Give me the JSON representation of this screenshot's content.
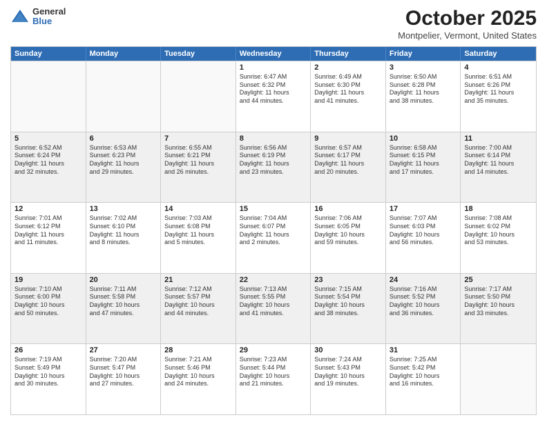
{
  "logo": {
    "general": "General",
    "blue": "Blue"
  },
  "header": {
    "month": "October 2025",
    "location": "Montpelier, Vermont, United States"
  },
  "days": [
    "Sunday",
    "Monday",
    "Tuesday",
    "Wednesday",
    "Thursday",
    "Friday",
    "Saturday"
  ],
  "weeks": [
    [
      {
        "day": "",
        "info": ""
      },
      {
        "day": "",
        "info": ""
      },
      {
        "day": "",
        "info": ""
      },
      {
        "day": "1",
        "info": "Sunrise: 6:47 AM\nSunset: 6:32 PM\nDaylight: 11 hours\nand 44 minutes."
      },
      {
        "day": "2",
        "info": "Sunrise: 6:49 AM\nSunset: 6:30 PM\nDaylight: 11 hours\nand 41 minutes."
      },
      {
        "day": "3",
        "info": "Sunrise: 6:50 AM\nSunset: 6:28 PM\nDaylight: 11 hours\nand 38 minutes."
      },
      {
        "day": "4",
        "info": "Sunrise: 6:51 AM\nSunset: 6:26 PM\nDaylight: 11 hours\nand 35 minutes."
      }
    ],
    [
      {
        "day": "5",
        "info": "Sunrise: 6:52 AM\nSunset: 6:24 PM\nDaylight: 11 hours\nand 32 minutes."
      },
      {
        "day": "6",
        "info": "Sunrise: 6:53 AM\nSunset: 6:23 PM\nDaylight: 11 hours\nand 29 minutes."
      },
      {
        "day": "7",
        "info": "Sunrise: 6:55 AM\nSunset: 6:21 PM\nDaylight: 11 hours\nand 26 minutes."
      },
      {
        "day": "8",
        "info": "Sunrise: 6:56 AM\nSunset: 6:19 PM\nDaylight: 11 hours\nand 23 minutes."
      },
      {
        "day": "9",
        "info": "Sunrise: 6:57 AM\nSunset: 6:17 PM\nDaylight: 11 hours\nand 20 minutes."
      },
      {
        "day": "10",
        "info": "Sunrise: 6:58 AM\nSunset: 6:15 PM\nDaylight: 11 hours\nand 17 minutes."
      },
      {
        "day": "11",
        "info": "Sunrise: 7:00 AM\nSunset: 6:14 PM\nDaylight: 11 hours\nand 14 minutes."
      }
    ],
    [
      {
        "day": "12",
        "info": "Sunrise: 7:01 AM\nSunset: 6:12 PM\nDaylight: 11 hours\nand 11 minutes."
      },
      {
        "day": "13",
        "info": "Sunrise: 7:02 AM\nSunset: 6:10 PM\nDaylight: 11 hours\nand 8 minutes."
      },
      {
        "day": "14",
        "info": "Sunrise: 7:03 AM\nSunset: 6:08 PM\nDaylight: 11 hours\nand 5 minutes."
      },
      {
        "day": "15",
        "info": "Sunrise: 7:04 AM\nSunset: 6:07 PM\nDaylight: 11 hours\nand 2 minutes."
      },
      {
        "day": "16",
        "info": "Sunrise: 7:06 AM\nSunset: 6:05 PM\nDaylight: 10 hours\nand 59 minutes."
      },
      {
        "day": "17",
        "info": "Sunrise: 7:07 AM\nSunset: 6:03 PM\nDaylight: 10 hours\nand 56 minutes."
      },
      {
        "day": "18",
        "info": "Sunrise: 7:08 AM\nSunset: 6:02 PM\nDaylight: 10 hours\nand 53 minutes."
      }
    ],
    [
      {
        "day": "19",
        "info": "Sunrise: 7:10 AM\nSunset: 6:00 PM\nDaylight: 10 hours\nand 50 minutes."
      },
      {
        "day": "20",
        "info": "Sunrise: 7:11 AM\nSunset: 5:58 PM\nDaylight: 10 hours\nand 47 minutes."
      },
      {
        "day": "21",
        "info": "Sunrise: 7:12 AM\nSunset: 5:57 PM\nDaylight: 10 hours\nand 44 minutes."
      },
      {
        "day": "22",
        "info": "Sunrise: 7:13 AM\nSunset: 5:55 PM\nDaylight: 10 hours\nand 41 minutes."
      },
      {
        "day": "23",
        "info": "Sunrise: 7:15 AM\nSunset: 5:54 PM\nDaylight: 10 hours\nand 38 minutes."
      },
      {
        "day": "24",
        "info": "Sunrise: 7:16 AM\nSunset: 5:52 PM\nDaylight: 10 hours\nand 36 minutes."
      },
      {
        "day": "25",
        "info": "Sunrise: 7:17 AM\nSunset: 5:50 PM\nDaylight: 10 hours\nand 33 minutes."
      }
    ],
    [
      {
        "day": "26",
        "info": "Sunrise: 7:19 AM\nSunset: 5:49 PM\nDaylight: 10 hours\nand 30 minutes."
      },
      {
        "day": "27",
        "info": "Sunrise: 7:20 AM\nSunset: 5:47 PM\nDaylight: 10 hours\nand 27 minutes."
      },
      {
        "day": "28",
        "info": "Sunrise: 7:21 AM\nSunset: 5:46 PM\nDaylight: 10 hours\nand 24 minutes."
      },
      {
        "day": "29",
        "info": "Sunrise: 7:23 AM\nSunset: 5:44 PM\nDaylight: 10 hours\nand 21 minutes."
      },
      {
        "day": "30",
        "info": "Sunrise: 7:24 AM\nSunset: 5:43 PM\nDaylight: 10 hours\nand 19 minutes."
      },
      {
        "day": "31",
        "info": "Sunrise: 7:25 AM\nSunset: 5:42 PM\nDaylight: 10 hours\nand 16 minutes."
      },
      {
        "day": "",
        "info": ""
      }
    ]
  ]
}
